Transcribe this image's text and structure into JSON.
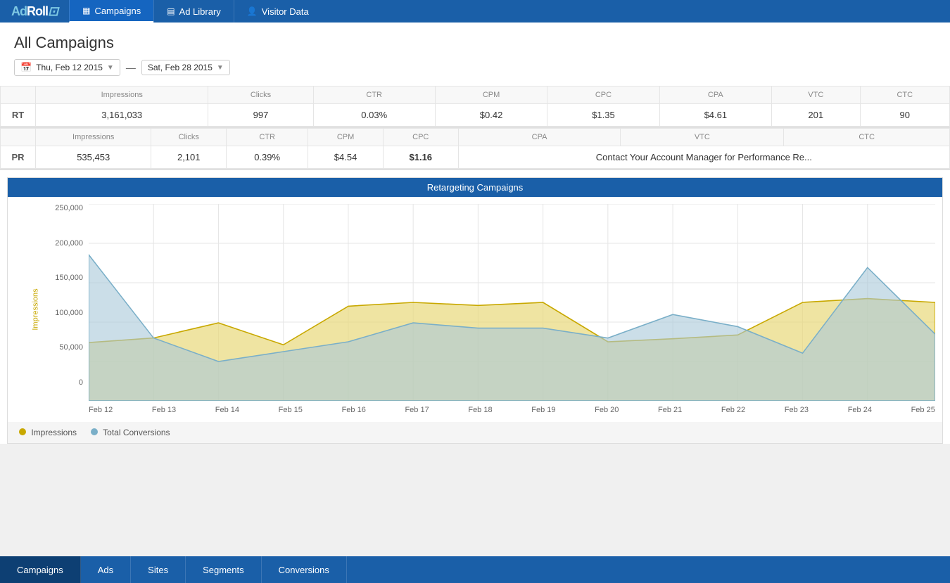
{
  "app": {
    "logo": "AdRoll",
    "nav": [
      {
        "id": "campaigns",
        "label": "Campaigns",
        "icon": "▦",
        "active": true
      },
      {
        "id": "ad-library",
        "label": "Ad Library",
        "icon": "▤",
        "active": false
      },
      {
        "id": "visitor-data",
        "label": "Visitor Data",
        "icon": "👤",
        "active": false
      }
    ]
  },
  "page": {
    "title": "All Campaigns",
    "date_start": "Thu, Feb 12 2015",
    "date_end": "Sat, Feb 28 2015"
  },
  "table_rt": {
    "columns": [
      "Impressions",
      "Clicks",
      "CTR",
      "CPM",
      "CPC",
      "CPA",
      "VTC",
      "CTC"
    ],
    "row_label": "RT",
    "impressions": "3,161,033",
    "clicks": "997",
    "ctr": "0.03%",
    "cpm": "$0.42",
    "cpc": "$1.35",
    "cpa": "$4.61",
    "vtc": "201",
    "ctc": "90"
  },
  "table_pr": {
    "columns": [
      "Impressions",
      "Clicks",
      "CTR",
      "CPM",
      "CPC",
      "CPA",
      "VTC",
      "CTC"
    ],
    "row_label": "PR",
    "impressions": "535,453",
    "clicks": "2,101",
    "ctr": "0.39%",
    "cpm": "$4.54",
    "cpc": "$1.16",
    "cpa": "",
    "vtc": "",
    "ctc": "",
    "contact_msg": "Contact Your Account Manager for Performance Re..."
  },
  "chart": {
    "title": "Retargeting Campaigns",
    "y_label": "Impressions",
    "x_labels": [
      "Feb 12",
      "Feb 13",
      "Feb 14",
      "Feb 15",
      "Feb 16",
      "Feb 17",
      "Feb 18",
      "Feb 19",
      "Feb 20",
      "Feb 21",
      "Feb 22",
      "Feb 23",
      "Feb 24",
      "Feb 25"
    ],
    "y_ticks": [
      "250,000",
      "200,000",
      "150,000",
      "100,000",
      "50,000",
      "0"
    ],
    "legend": [
      {
        "label": "Impressions",
        "color": "#d4b83a"
      },
      {
        "label": "Total Conversions",
        "color": "#a8c8d8"
      }
    ]
  },
  "bottom_tabs": [
    {
      "id": "campaigns",
      "label": "Campaigns",
      "active": true
    },
    {
      "id": "ads",
      "label": "Ads",
      "active": false
    },
    {
      "id": "sites",
      "label": "Sites",
      "active": false
    },
    {
      "id": "segments",
      "label": "Segments",
      "active": false
    },
    {
      "id": "conversions",
      "label": "Conversions",
      "active": false
    }
  ]
}
